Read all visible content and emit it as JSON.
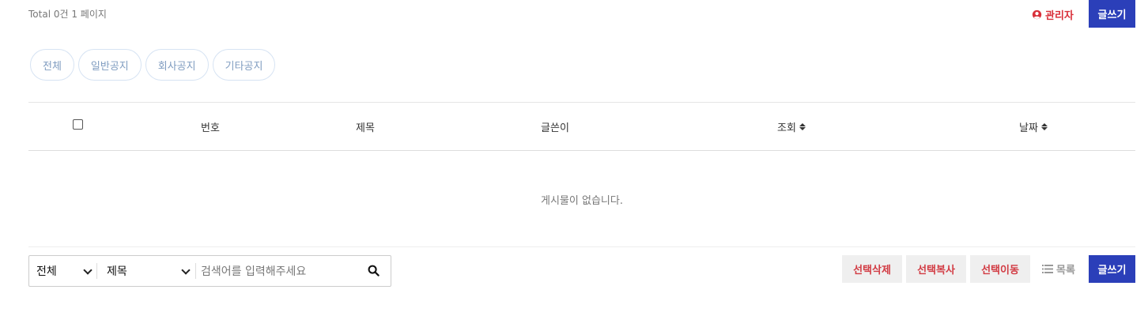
{
  "header": {
    "total_text": "Total 0건 1 페이지",
    "admin_label": "관리자",
    "write_label": "글쓰기"
  },
  "categories": [
    "전체",
    "일반공지",
    "회사공지",
    "기타공지"
  ],
  "table": {
    "columns": {
      "number": "번호",
      "subject": "제목",
      "author": "글쓴이",
      "views": "조회",
      "date": "날짜"
    },
    "empty_message": "게시물이 없습니다."
  },
  "search": {
    "scope_value": "전체",
    "field_value": "제목",
    "placeholder": "검색어를 입력해주세요"
  },
  "actions": {
    "delete_label": "선택삭제",
    "copy_label": "선택복사",
    "move_label": "선택이동",
    "list_label": "목록",
    "write_label": "글쓰기"
  },
  "colors": {
    "primary": "#2b3fb9",
    "danger": "#d23c44"
  },
  "icons": {
    "admin": "user-circle-icon",
    "search": "search-icon",
    "list": "list-icon",
    "sort": "sort-icon"
  }
}
